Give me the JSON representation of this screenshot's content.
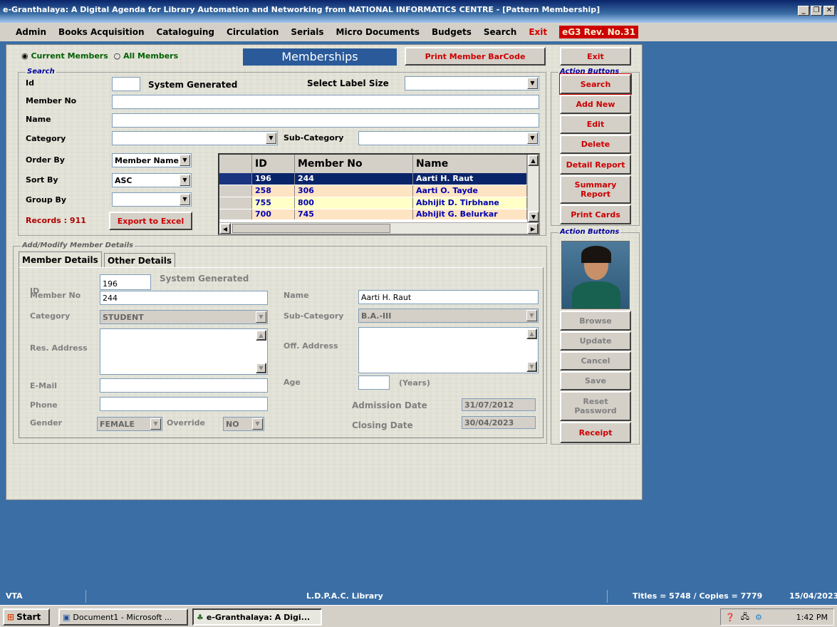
{
  "window": {
    "title": "e-Granthalaya: A Digital Agenda for Library Automation and Networking from NATIONAL INFORMATICS CENTRE - [Pattern Membership]"
  },
  "menu": [
    "Admin",
    "Books Acquisition",
    "Cataloguing",
    "Circulation",
    "Serials",
    "Micro Documents",
    "Budgets",
    "Search",
    "Exit"
  ],
  "revision": "eG3 Rev. No.31",
  "top": {
    "current_members": "Current Members",
    "all_members": "All Members",
    "heading": "Memberships",
    "print_barcode": "Print Member BarCode"
  },
  "search": {
    "legend": "Search",
    "id_label": "Id",
    "system_generated": "System Generated",
    "label_size_label": "Select Label Size",
    "member_no_label": "Member No",
    "name_label": "Name",
    "category_label": "Category",
    "subcategory_label": "Sub-Category",
    "order_by_label": "Order By",
    "order_by_value": "Member Name",
    "sort_by_label": "Sort By",
    "sort_by_value": "ASC",
    "group_by_label": "Group By",
    "records": "Records : 911",
    "export": "Export to Excel"
  },
  "grid": {
    "headers": [
      "ID",
      "Member No",
      "Name"
    ],
    "rows": [
      {
        "id": "196",
        "member_no": "244",
        "name": "Aarti H. Raut"
      },
      {
        "id": "258",
        "member_no": "306",
        "name": "Aarti O. Tayde"
      },
      {
        "id": "755",
        "member_no": "800",
        "name": "Abhijit D. Tirbhane"
      },
      {
        "id": "700",
        "member_no": "745",
        "name": "Abhijit G. Belurkar"
      }
    ]
  },
  "action_buttons_1": {
    "legend": "Action Buttons",
    "exit": "Exit",
    "search": "Search",
    "add_new": "Add New",
    "edit": "Edit",
    "delete": "Delete",
    "detail_report": "Detail Report",
    "summary_report": "Summary Report",
    "print_cards": "Print Cards"
  },
  "action_buttons_2": {
    "legend": "Action Buttons",
    "browse": "Browse",
    "update": "Update",
    "cancel": "Cancel",
    "save": "Save",
    "reset_password": "Reset Password",
    "receipt": "Receipt"
  },
  "details": {
    "legend": "Add/Modify Member Details",
    "tab1": "Member Details",
    "tab2": "Other Details",
    "id_label": "ID",
    "id_value": "196",
    "system_generated": "System Generated",
    "member_no_label": "Member No",
    "member_no_value": "244",
    "name_label": "Name",
    "name_value": "Aarti H. Raut",
    "category_label": "Category",
    "category_value": "STUDENT",
    "subcategory_label": "Sub-Category",
    "subcategory_value": "B.A.-III",
    "res_address_label": "Res. Address",
    "off_address_label": "Off. Address",
    "email_label": "E-Mail",
    "age_label": "Age",
    "years": "(Years)",
    "phone_label": "Phone",
    "admission_label": "Admission Date",
    "admission_value": "31/07/2012",
    "gender_label": "Gender",
    "gender_value": "FEMALE",
    "override_label": "Override",
    "override_value": "NO",
    "closing_label": "Closing Date",
    "closing_value": "30/04/2023"
  },
  "status": {
    "left": "VTA",
    "center": "L.D.P.A.C. Library",
    "counts": "Titles = 5748 / Copies = 7779",
    "date": "15/04/2023"
  },
  "taskbar": {
    "start": "Start",
    "task1": "Document1 - Microsoft ...",
    "task2": "e-Granthalaya: A Digi...",
    "time": "1:42 PM"
  }
}
